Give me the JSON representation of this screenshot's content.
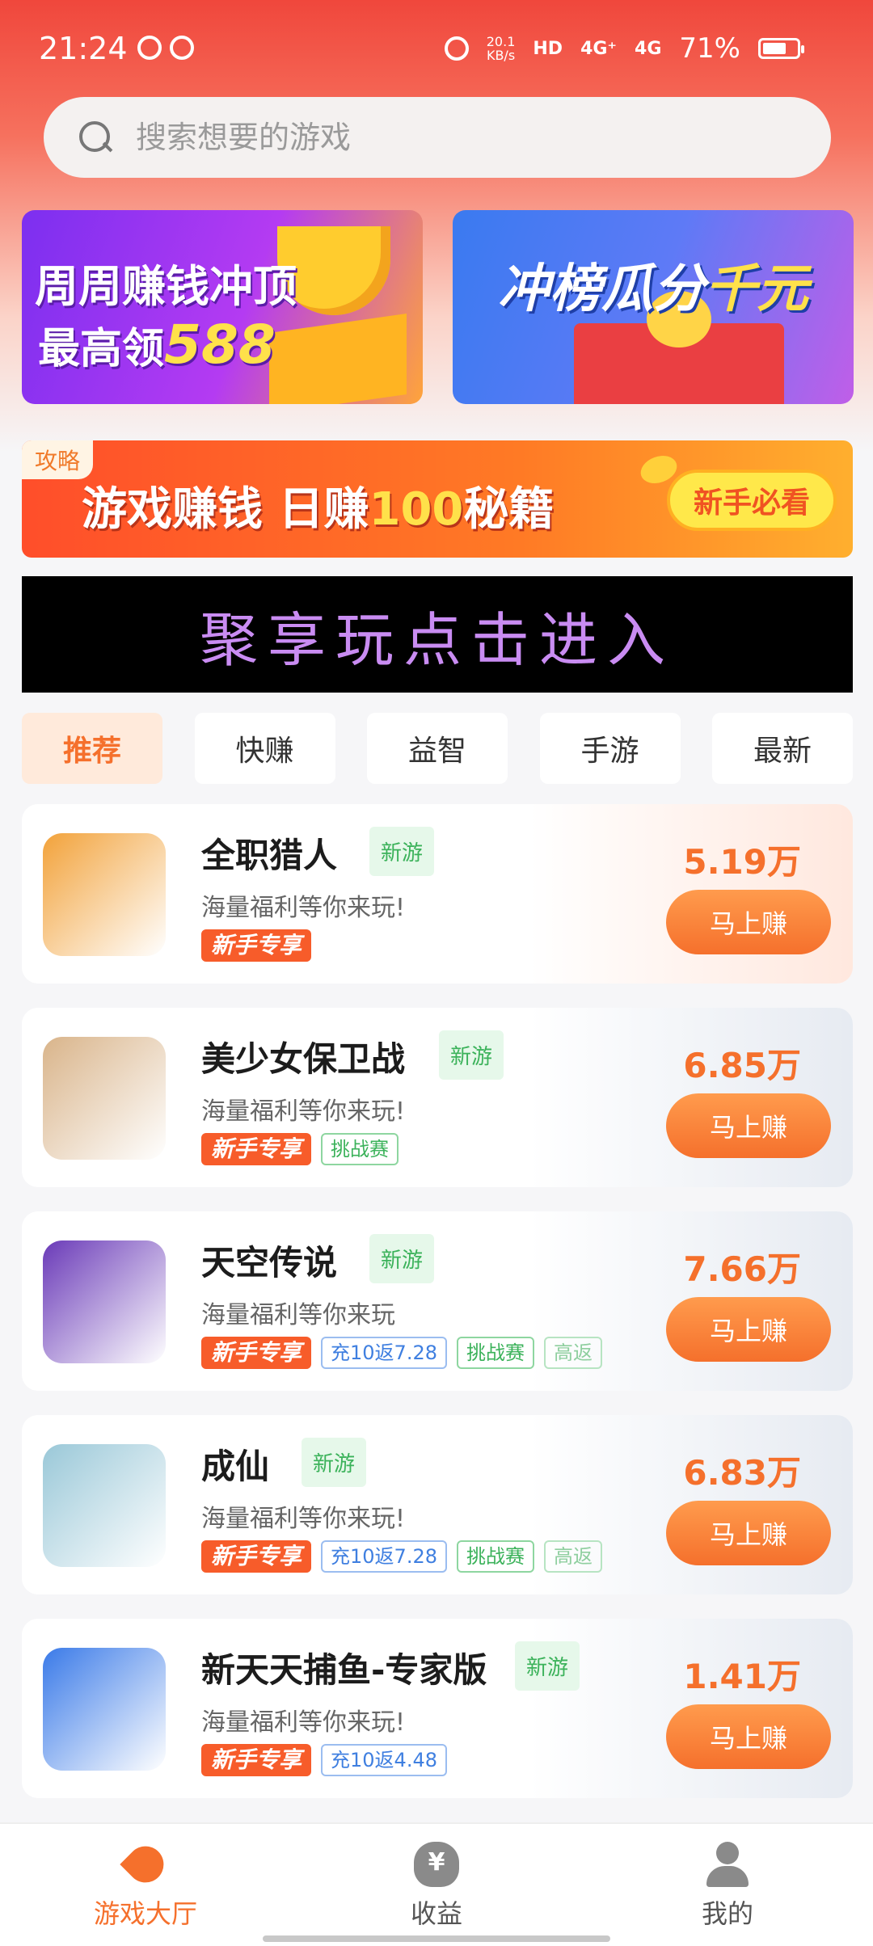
{
  "status_bar": {
    "time": "21:24",
    "net_speed": "20.1",
    "net_unit": "KB/s",
    "hd": "HD",
    "sig1": "4G⁺",
    "sig2": "4G",
    "battery": "71%",
    "battery_level": 0.71
  },
  "search": {
    "placeholder": "搜索想要的游戏"
  },
  "promo_left": {
    "line1": "周周赚钱冲顶",
    "line2_prefix": "最高领",
    "line2_num": "588"
  },
  "promo_right": {
    "text_a": "冲榜瓜分",
    "text_b": "千元"
  },
  "guide_banner": {
    "tag": "攻略",
    "title_a": "游戏赚钱 日赚",
    "title_num": "100",
    "title_b": "秘籍",
    "button": "新手必看"
  },
  "enter_banner": {
    "text": "聚享玩点击进入"
  },
  "tabs": [
    {
      "label": "推荐"
    },
    {
      "label": "快赚"
    },
    {
      "label": "益智"
    },
    {
      "label": "手游"
    },
    {
      "label": "最新"
    }
  ],
  "badge_labels": {
    "newbie": "新手专享",
    "challenge": "挑战赛",
    "high": "高返",
    "new": "新游",
    "earn": "马上赚"
  },
  "games": [
    {
      "name": "全职猎人",
      "desc": "海量福利等你来玩!",
      "amount": "5.19万",
      "rebate": "",
      "challenge": false,
      "high": false,
      "icon_color": "#f2a23a"
    },
    {
      "name": "美少女保卫战",
      "desc": "海量福利等你来玩!",
      "amount": "6.85万",
      "rebate": "",
      "challenge": true,
      "high": false,
      "icon_color": "#d9b48a"
    },
    {
      "name": "天空传说",
      "desc": "海量福利等你来玩",
      "amount": "7.66万",
      "rebate": "充10返7.28",
      "challenge": true,
      "high": true,
      "icon_color": "#6a3ab8"
    },
    {
      "name": "成仙",
      "desc": "海量福利等你来玩!",
      "amount": "6.83万",
      "rebate": "充10返7.28",
      "challenge": true,
      "high": true,
      "icon_color": "#9ac8d8"
    },
    {
      "name": "新天天捕鱼-专家版",
      "desc": "海量福利等你来玩!",
      "amount": "1.41万",
      "rebate": "充10返4.48",
      "challenge": false,
      "high": false,
      "icon_color": "#3a7ae8"
    }
  ],
  "bottom_nav": [
    {
      "label": "游戏大厅",
      "icon": "rocket-icon"
    },
    {
      "label": "收益",
      "icon": "money-bag-icon"
    },
    {
      "label": "我的",
      "icon": "person-icon"
    }
  ],
  "colors": {
    "accent": "#f5702c",
    "new_tag": "#3bb25a",
    "hero_red": "#f0473c"
  }
}
